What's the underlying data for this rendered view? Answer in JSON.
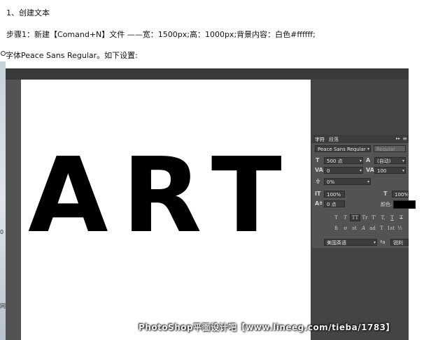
{
  "doc": {
    "line1": "1、创建文本",
    "line2": "步骤1：新建【Comand+N】文件 ——宽：1500px;高：1000px;背景内容：白色#ffffff;",
    "line3": "字体Peace Sans Regular。如下设置:"
  },
  "gutter": {
    "mark1": "0",
    "mark2": "网"
  },
  "canvas": {
    "text": "ART"
  },
  "panel": {
    "tab_character": "字符",
    "tab_paragraph": "段落",
    "collapse_icon": "▸▸",
    "menu_icon": "≡",
    "font_family": "Peace Sans Regular",
    "font_style": "Regular",
    "font_size": "500 点",
    "leading": "(自动)",
    "kerning": "0",
    "tracking": "100",
    "scale_percent": "0%",
    "vertical_scale": "100%",
    "horizontal_scale": "100%",
    "baseline_shift": "0 点",
    "color_label": "颜色:",
    "text_color": "#000000",
    "type_styles_1": [
      "T",
      "T",
      "TT",
      "Tr",
      "T'",
      "T,",
      "T",
      "T"
    ],
    "type_styles_2": [
      "fi",
      "ơ",
      "st",
      "A",
      "ad",
      "T",
      "1st",
      "½"
    ],
    "language": "美国英语",
    "aa_label": "ªa",
    "antialias": "锐利"
  },
  "watermark": "PhotoShop平面设计吧【www.lineeg.com/tieba/1783】",
  "colors": {
    "ps_panel": "#535353",
    "ps_dark": "#3a3a3a",
    "canvas": "#ffffff"
  }
}
